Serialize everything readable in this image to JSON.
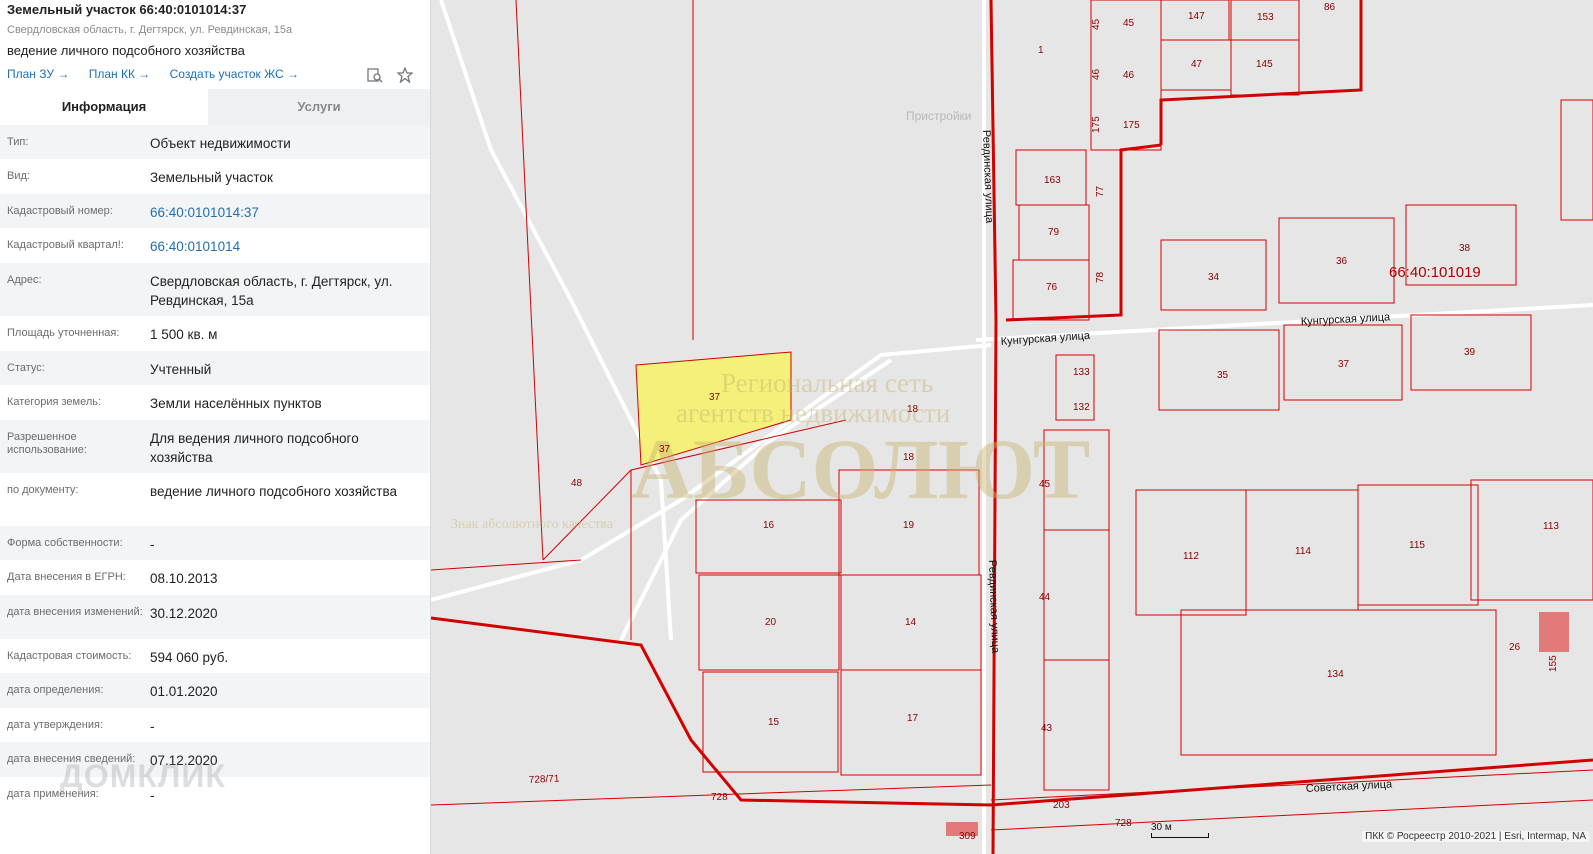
{
  "header": {
    "title": "Земельный участок 66:40:0101014:37",
    "subaddress": "Свердловская область, г. Дегтярск, ул. Ревдинская, 15а",
    "purpose": "ведение личного подсобного хозяйства",
    "links": [
      "План ЗУ →",
      "План КК →",
      "Создать участок ЖС →"
    ]
  },
  "tabs": {
    "info": "Информация",
    "services": "Услуги"
  },
  "rows": [
    {
      "label": "Тип:",
      "value": "Объект недвижимости"
    },
    {
      "label": "Вид:",
      "value": "Земельный участок"
    },
    {
      "label": "Кадастровый номер:",
      "value": "66:40:0101014:37"
    },
    {
      "label": "Кадастровый квартал!:",
      "value": "66:40:0101014"
    },
    {
      "label": "Адрес:",
      "value": "Свердловская область, г. Дегтярск, ул. Ревдинская, 15а"
    },
    {
      "label": "Площадь уточненная:",
      "value": "1 500 кв. м"
    },
    {
      "label": "Статус:",
      "value": "Учтенный"
    },
    {
      "label": "Категория земель:",
      "value": "Земли населённых пунктов"
    },
    {
      "label": "Разрешенное использование:",
      "value": "Для ведения личного подсобного хозяйства"
    },
    {
      "label": "по документу:",
      "value": "ведение личного подсобного хозяйства"
    },
    {
      "label": "Форма собственности:",
      "value": "-"
    },
    {
      "label": "Дата внесения в ЕГРН:",
      "value": "08.10.2013"
    },
    {
      "label": "дата внесения изменений:",
      "value": "30.12.2020"
    },
    {
      "label": "Кадастровая стоимость:",
      "value": "594 060 руб."
    },
    {
      "label": "дата определения:",
      "value": "01.01.2020"
    },
    {
      "label": "дата утверждения:",
      "value": "-"
    },
    {
      "label": "дата внесения сведений:",
      "value": "07.12.2020"
    },
    {
      "label": "дата применения:",
      "value": "-"
    }
  ],
  "watermark": "ДОМКЛИК",
  "map": {
    "streets": [
      "Ревдинская улица",
      "Кунгурская улица",
      "Советская улица"
    ],
    "quarter": "66:40:101019",
    "attribution": "ПКК © Росреестр 2010-2021 | Esri, Intermap, NA",
    "scale": "30 м",
    "plots": [
      "37",
      "48",
      "18",
      "16",
      "19",
      "20",
      "14",
      "15",
      "17",
      "45",
      "44",
      "43",
      "133",
      "132",
      "35",
      "37",
      "39",
      "34",
      "36",
      "38",
      "163",
      "79",
      "76",
      "77",
      "78",
      "1",
      "175",
      "175",
      "46",
      "46",
      "45",
      "45",
      "147",
      "153",
      "86",
      "47",
      "145",
      "112",
      "114",
      "115",
      "113",
      "134",
      "26",
      "155",
      "728/71",
      "728",
      "203",
      "728",
      "309",
      "37"
    ],
    "watermark_lines": [
      "Региональная сеть",
      "агентств недвижимости",
      "АБСОЛЮТ",
      "Знак абсолютного качества"
    ],
    "faded_label": "Пристройки"
  }
}
